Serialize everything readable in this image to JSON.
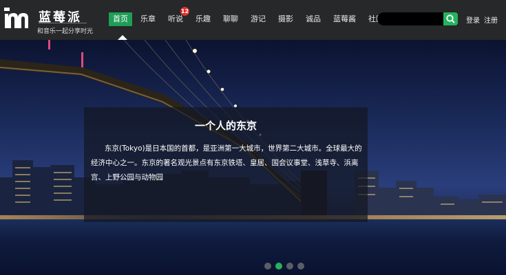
{
  "brand": {
    "name": "蓝莓派",
    "slogan": "和音乐一起分享时光"
  },
  "nav": {
    "items": [
      {
        "label": "首页",
        "active": true
      },
      {
        "label": "乐章"
      },
      {
        "label": "听说",
        "badge": "12"
      },
      {
        "label": "乐趣"
      },
      {
        "label": "聊聊"
      },
      {
        "label": "游记"
      },
      {
        "label": "摄影"
      },
      {
        "label": "诚品"
      },
      {
        "label": "蓝莓酱"
      },
      {
        "label": "社区"
      }
    ]
  },
  "search": {
    "placeholder": "",
    "icon": "search-icon"
  },
  "auth": {
    "login": "登录",
    "register": "注册"
  },
  "banner": {
    "title": "一个人的东京",
    "text": "东京(Tokyo)是日本国的首都，是亚洲第一大城市，世界第二大城市。全球最大的经济中心之一。东京的著名观光景点有东京铁塔、皇居、国会议事堂、浅草寺、浜离宫、上野公园与动物园",
    "slides": 4,
    "active_slide": 2
  },
  "colors": {
    "accent": "#25b25f",
    "header_bg": "#262829",
    "badge": "#e0302b"
  }
}
